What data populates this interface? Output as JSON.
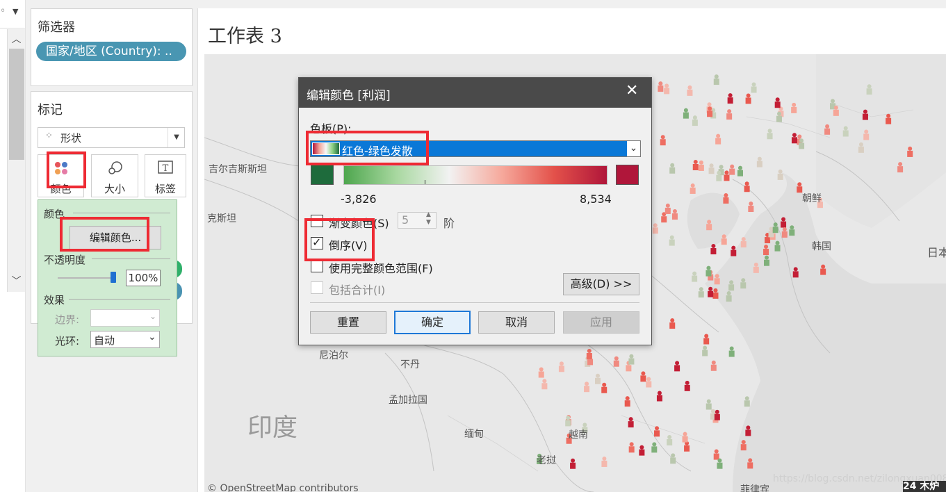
{
  "filters": {
    "title": "筛选器",
    "pill": "国家/地区 (Country): .."
  },
  "marks": {
    "title": "标记",
    "mark_type": "形状",
    "buttons": {
      "color": "颜色",
      "size": "大小",
      "label": "标签"
    }
  },
  "color_popup": {
    "section_color": "颜色",
    "edit_colors_button": "编辑颜色...",
    "opacity_label": "不透明度",
    "opacity_value": "100%",
    "opacity_level": 1.0,
    "effects_label": "效果",
    "border_label": "边界:",
    "border_value": "",
    "halo_label": "光环:",
    "halo_value": "自动"
  },
  "sheet": {
    "title": "工作表 3",
    "attribution": "© OpenStreetMap contributors",
    "watermark": "https://blog.csdn.net/zilongxuan008",
    "corner_text": "24 木炉"
  },
  "map_labels": [
    "吉尔吉斯斯坦",
    "克斯坦",
    "尼泊尔",
    "不丹",
    "孟加拉国",
    "印度",
    "缅甸",
    "越南",
    "老挝",
    "菲律宾",
    "朝鲜",
    "韩国",
    "日本"
  ],
  "dialog": {
    "title": "编辑颜色 [利润]",
    "close_icon": "close-icon",
    "palette_label": "色板(P):",
    "palette_value": "红色-绿色发散",
    "min_value": "-3,826",
    "max_value": "8,534",
    "stepped_label": "渐变颜色(S)",
    "stepped_steps": "5",
    "steps_unit": "阶",
    "reversed_label": "倒序(V)",
    "reversed_checked": true,
    "full_range_label": "使用完整颜色范围(F)",
    "include_totals_label": "包括合计(I)",
    "advanced_button": "高级(D) >>",
    "reset_button": "重置",
    "ok_button": "确定",
    "cancel_button": "取消",
    "apply_button": "应用",
    "colors": {
      "start": "#1e6b3c",
      "end": "#b0163a",
      "accent": "#0a78d7",
      "highlight": "#ee2a33"
    }
  }
}
